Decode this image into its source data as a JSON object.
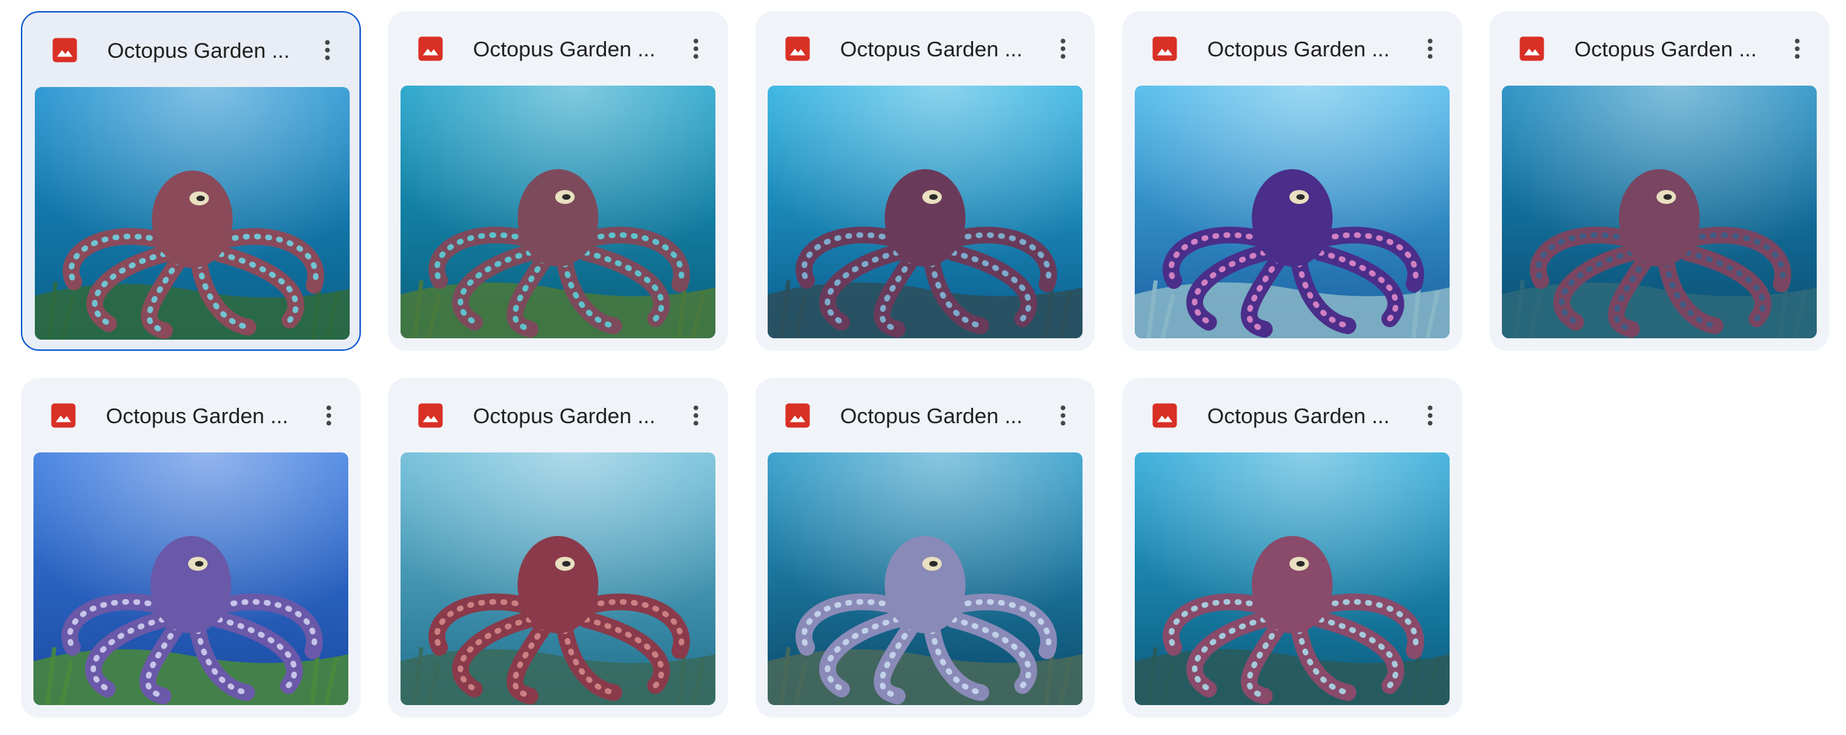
{
  "files": [
    {
      "name": "Octopus Garden ...",
      "selected": true,
      "palette": {
        "top": "#1a8fd0",
        "bottom": "#0b5f86",
        "floor": "#2f6a3c",
        "octo": "#8a4a5a",
        "suckers": "#6fd2e0"
      }
    },
    {
      "name": "Octopus Garden ...",
      "selected": false,
      "palette": {
        "top": "#1aa0c8",
        "bottom": "#0b5e7d",
        "floor": "#4a7a3a",
        "octo": "#7d4a5c",
        "suckers": "#5ccfd8"
      }
    },
    {
      "name": "Octopus Garden ...",
      "selected": false,
      "palette": {
        "top": "#2ab0e0",
        "bottom": "#0a5c8c",
        "floor": "#2d4f5a",
        "octo": "#6a3a5a",
        "suckers": "#7fb8d8"
      }
    },
    {
      "name": "Octopus Garden ...",
      "selected": false,
      "palette": {
        "top": "#4ab8ea",
        "bottom": "#1a5fa0",
        "floor": "#8ab8c8",
        "octo": "#4a2e8a",
        "suckers": "#e08ac8"
      }
    },
    {
      "name": "Octopus Garden ...",
      "selected": false,
      "palette": {
        "top": "#1a8ac0",
        "bottom": "#0b4f72",
        "floor": "#2e6a7a",
        "octo": "#7a4560",
        "suckers": "#3a5f8a"
      }
    },
    {
      "name": "Octopus Garden ...",
      "selected": false,
      "palette": {
        "top": "#3a7ae0",
        "bottom": "#1a4aa0",
        "floor": "#4a8a3a",
        "octo": "#6a58a8",
        "suckers": "#d0d0f0"
      }
    },
    {
      "name": "Octopus Garden ...",
      "selected": false,
      "palette": {
        "top": "#6abcd8",
        "bottom": "#1f6f8c",
        "floor": "#3a6a5a",
        "octo": "#8a3a4a",
        "suckers": "#d08a8a"
      }
    },
    {
      "name": "Octopus Garden ...",
      "selected": false,
      "palette": {
        "top": "#2a9ac8",
        "bottom": "#0b4a6a",
        "floor": "#4a6a5a",
        "octo": "#8a8ab8",
        "suckers": "#c8d8f0"
      }
    },
    {
      "name": "Octopus Garden ...",
      "selected": false,
      "palette": {
        "top": "#2aa8d8",
        "bottom": "#0b5a7a",
        "floor": "#2a5a5a",
        "octo": "#8a4a6a",
        "suckers": "#a8d8e8"
      }
    }
  ]
}
